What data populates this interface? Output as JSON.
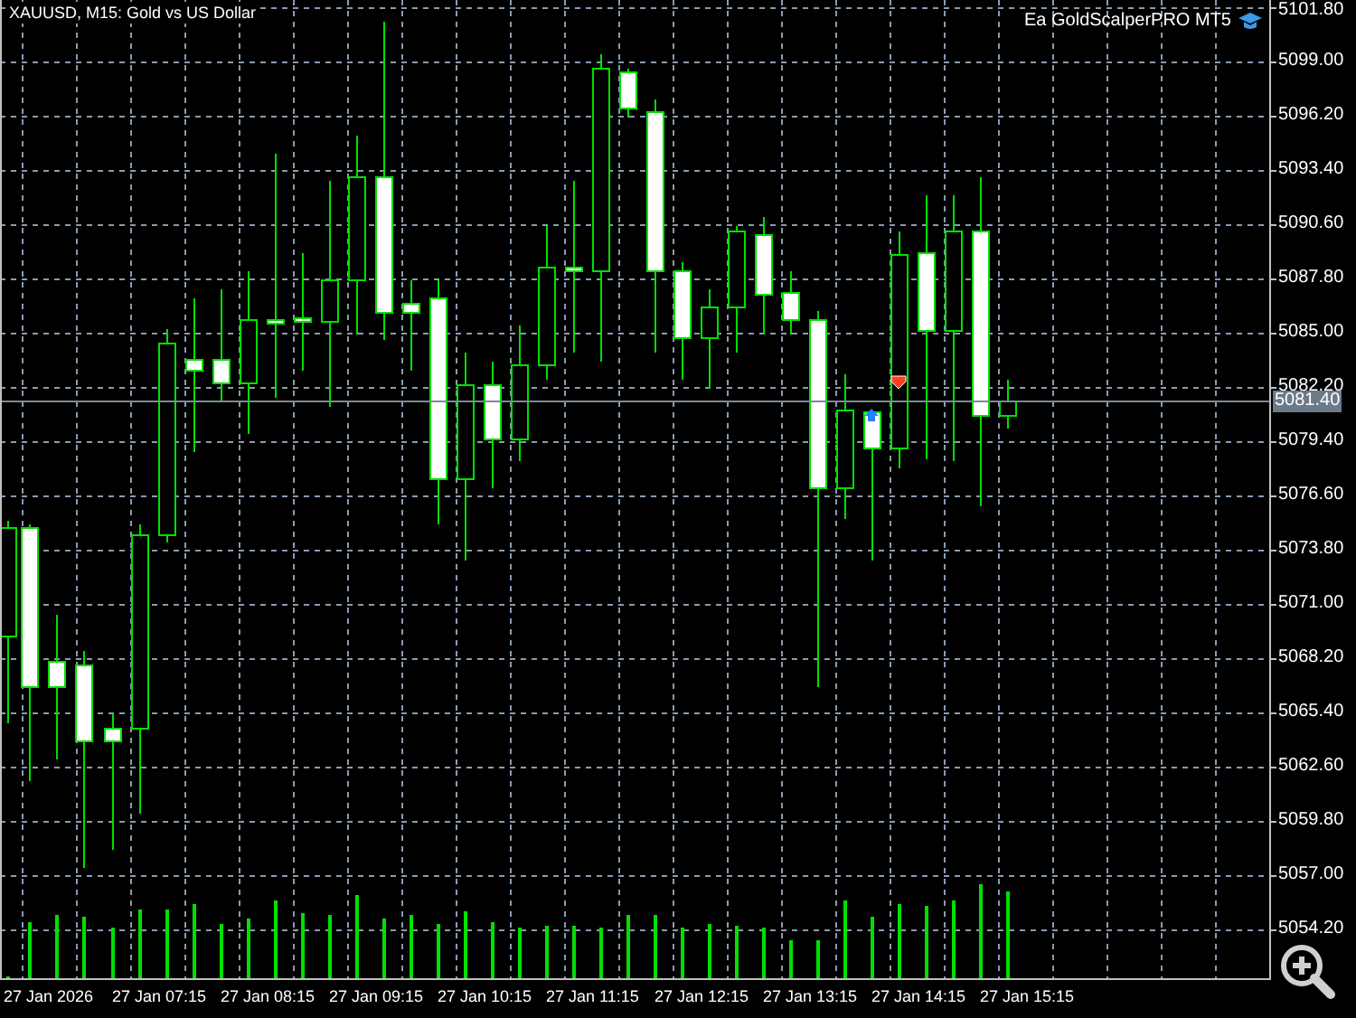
{
  "chart": {
    "title": "XAUUSD, M15:  Gold vs US Dollar",
    "expert": "Ea GoldScalperPRO MT5",
    "price_labels": [
      "5101.80",
      "5099.00",
      "5096.20",
      "5093.40",
      "5090.60",
      "5087.80",
      "5085.00",
      "5082.20",
      "5079.40",
      "5076.60",
      "5073.80",
      "5071.00",
      "5068.20",
      "5065.40",
      "5062.60",
      "5059.80",
      "5057.00",
      "5054.20"
    ],
    "current_price": "5081.40",
    "time_labels": [
      "27 Jan 2026",
      "27 Jan 07:15",
      "27 Jan 08:15",
      "27 Jan 09:15",
      "27 Jan 10:15",
      "27 Jan 11:15",
      "27 Jan 12:15",
      "27 Jan 13:15",
      "27 Jan 14:15",
      "27 Jan 15:15"
    ]
  }
}
